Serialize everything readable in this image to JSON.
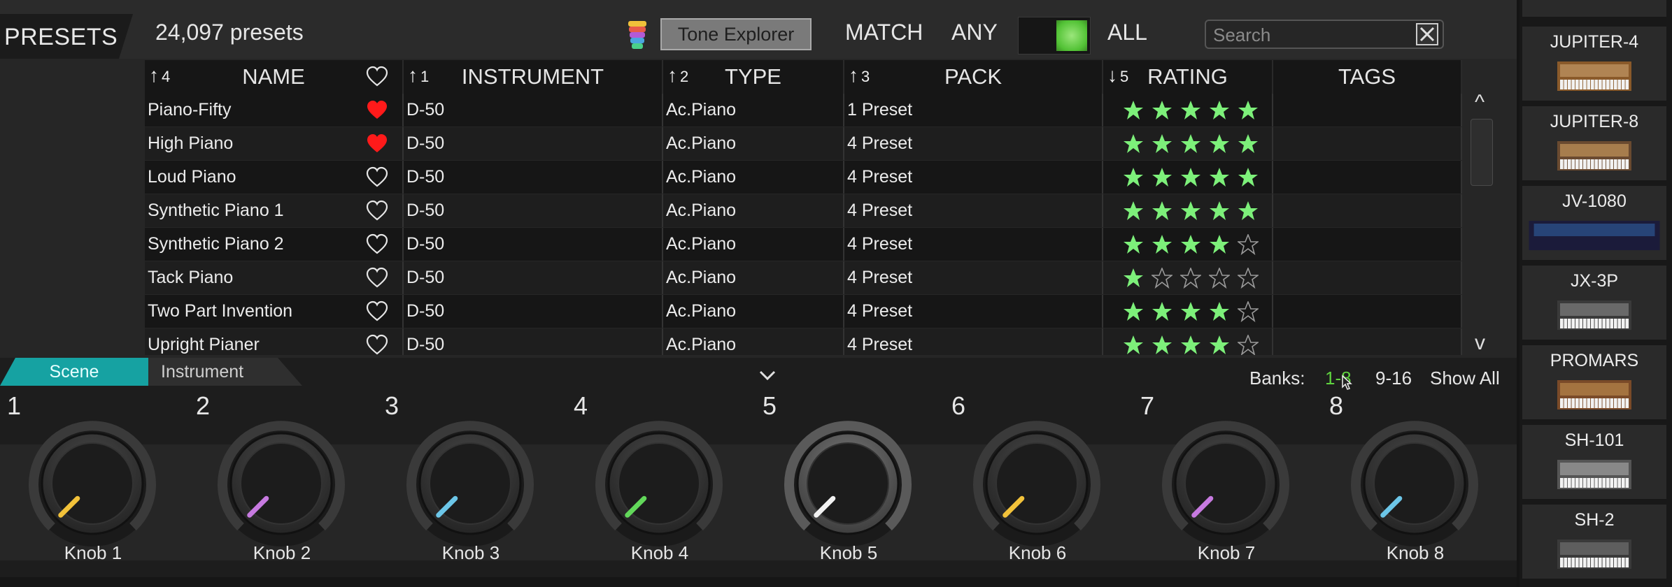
{
  "header": {
    "presets_tab": "PRESETS",
    "preset_count": "24,097 presets",
    "tone_explorer_label": "Tone Explorer",
    "match_label": "MATCH",
    "any_label": "ANY",
    "all_label": "ALL",
    "search_placeholder": "Search",
    "accent_color": "#52c235"
  },
  "table": {
    "columns": [
      {
        "label": "NAME",
        "sort_arrow": "↑",
        "sort_order": "4"
      },
      {
        "label": "INSTRUMENT",
        "sort_arrow": "↑",
        "sort_order": "1"
      },
      {
        "label": "TYPE",
        "sort_arrow": "↑",
        "sort_order": "2"
      },
      {
        "label": "PACK",
        "sort_arrow": "↑",
        "sort_order": "3"
      },
      {
        "label": "RATING",
        "sort_arrow": "↓",
        "sort_order": "5"
      },
      {
        "label": "TAGS",
        "sort_arrow": "",
        "sort_order": ""
      }
    ],
    "rows": [
      {
        "name": "Piano-Fifty",
        "favorite": true,
        "instrument": "D-50",
        "type": "Ac.Piano",
        "pack": "1 Preset",
        "rating": 5,
        "tags": ""
      },
      {
        "name": "High Piano",
        "favorite": true,
        "instrument": "D-50",
        "type": "Ac.Piano",
        "pack": "4 Preset",
        "rating": 5,
        "tags": ""
      },
      {
        "name": "Loud Piano",
        "favorite": false,
        "instrument": "D-50",
        "type": "Ac.Piano",
        "pack": "4 Preset",
        "rating": 5,
        "tags": ""
      },
      {
        "name": "Synthetic Piano 1",
        "favorite": false,
        "instrument": "D-50",
        "type": "Ac.Piano",
        "pack": "4 Preset",
        "rating": 5,
        "tags": ""
      },
      {
        "name": "Synthetic Piano 2",
        "favorite": false,
        "instrument": "D-50",
        "type": "Ac.Piano",
        "pack": "4 Preset",
        "rating": 4,
        "tags": ""
      },
      {
        "name": "Tack Piano",
        "favorite": false,
        "instrument": "D-50",
        "type": "Ac.Piano",
        "pack": "4 Preset",
        "rating": 1,
        "tags": ""
      },
      {
        "name": "Two Part Invention",
        "favorite": false,
        "instrument": "D-50",
        "type": "Ac.Piano",
        "pack": "4 Preset",
        "rating": 4,
        "tags": ""
      },
      {
        "name": "Upright Pianer",
        "favorite": false,
        "instrument": "D-50",
        "type": "Ac.Piano",
        "pack": "4 Preset",
        "rating": 4,
        "tags": ""
      }
    ],
    "star_color": "#7df07a",
    "heart_color": "#ff1a1a",
    "scroll_up": "^",
    "scroll_down": "v"
  },
  "bottom": {
    "tabs": [
      "Scene",
      "Instrument"
    ],
    "active_tab": "Scene",
    "banks_label": "Banks:",
    "banks": [
      "1-8",
      "9-16",
      "Show All"
    ],
    "active_bank": "1-8"
  },
  "knobs": [
    {
      "num": "1",
      "label": "Knob 1",
      "color": "#f2c23a",
      "value": 0
    },
    {
      "num": "2",
      "label": "Knob 2",
      "color": "#c77ae0",
      "value": 0
    },
    {
      "num": "3",
      "label": "Knob 3",
      "color": "#6cc6e8",
      "value": 0
    },
    {
      "num": "4",
      "label": "Knob 4",
      "color": "#62d85a",
      "value": 0
    },
    {
      "num": "5",
      "label": "Knob 5",
      "color": "#f2f2f2",
      "value": 0
    },
    {
      "num": "6",
      "label": "Knob 6",
      "color": "#f2c23a",
      "value": 0
    },
    {
      "num": "7",
      "label": "Knob 7",
      "color": "#c77ae0",
      "value": 0
    },
    {
      "num": "8",
      "label": "Knob 8",
      "color": "#6cc6e8",
      "value": 0
    }
  ],
  "instruments": [
    "JUPITER-4",
    "JUPITER-8",
    "JV-1080",
    "JX-3P",
    "PROMARS",
    "SH-101",
    "SH-2"
  ]
}
